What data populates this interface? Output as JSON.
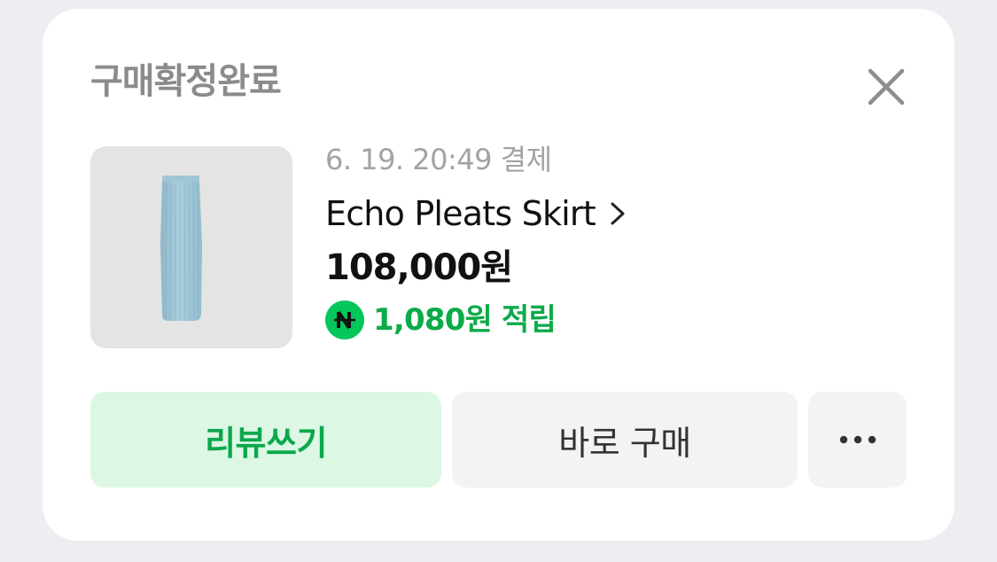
{
  "card": {
    "title": "구매확정완료",
    "close_icon": "close-icon"
  },
  "order": {
    "payment_datetime": "6. 19. 20:49 결제",
    "product_name": "Echo Pleats Skirt",
    "price": "108,000원",
    "points_icon": "naver-pay-n-icon",
    "points": "1,080원 적립"
  },
  "actions": {
    "review_label": "리뷰쓰기",
    "buy_again_label": "바로 구매",
    "more_icon": "more-dots-icon"
  },
  "colors": {
    "accent_green": "#03c75a",
    "points_text": "#0bab48",
    "review_bg": "#dcf7e4",
    "neutral_button_bg": "#f1f3f5",
    "page_bg": "#eceef1"
  }
}
